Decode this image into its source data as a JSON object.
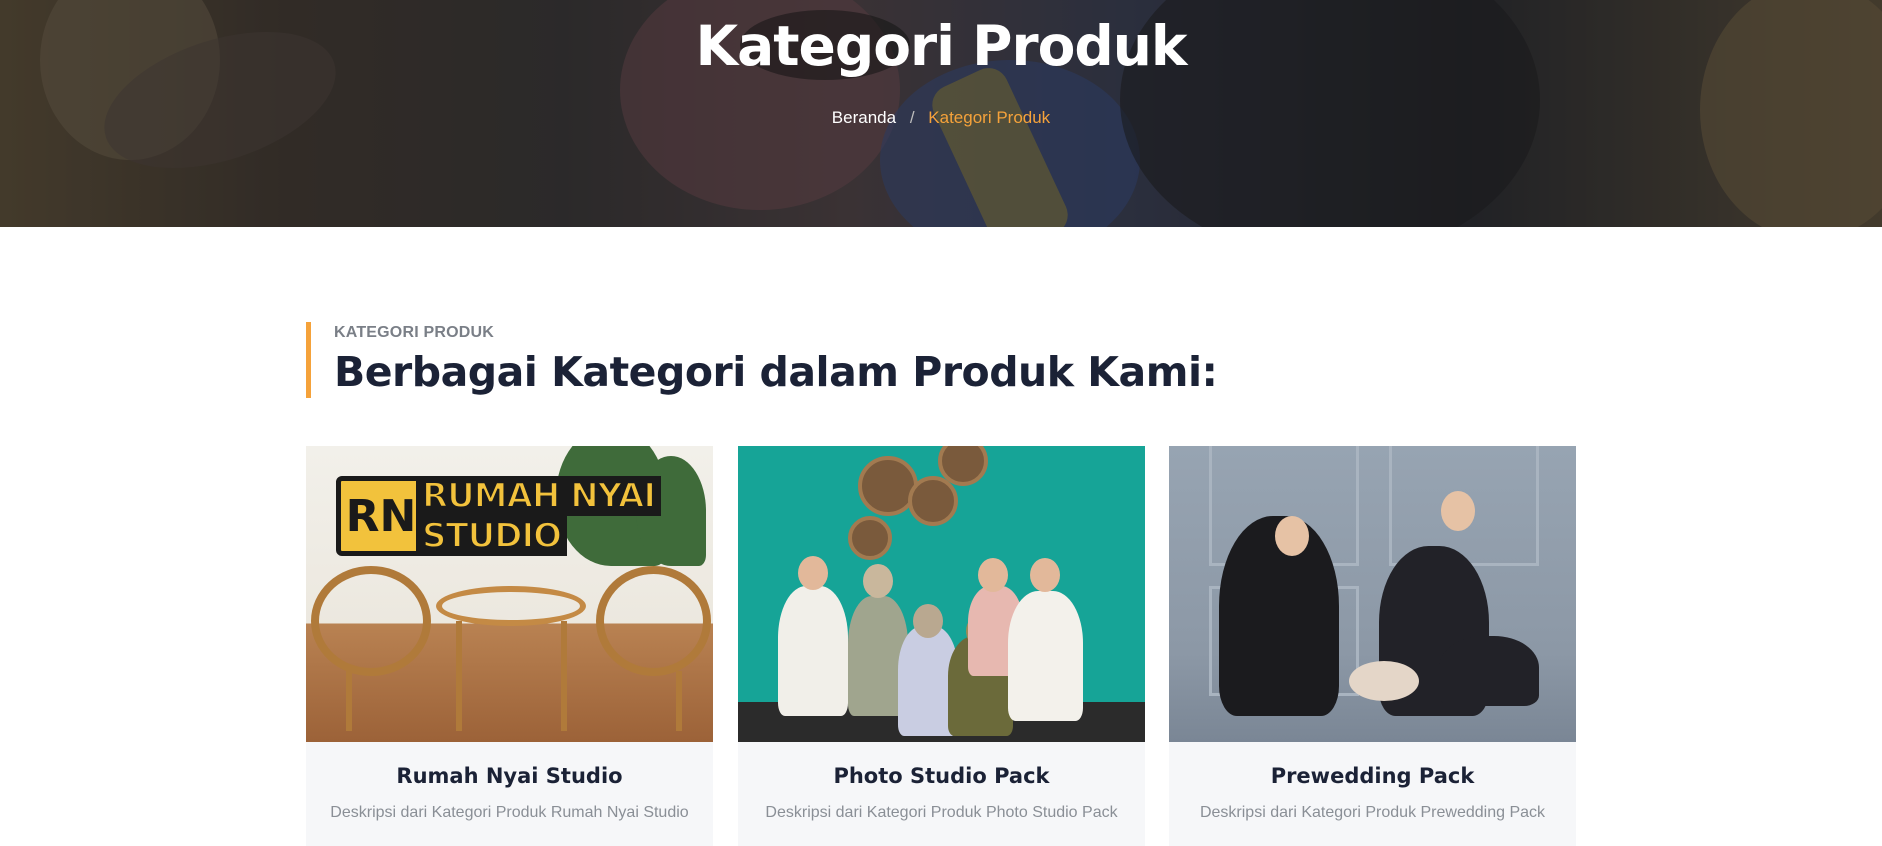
{
  "hero": {
    "title": "Kategori Produk",
    "breadcrumb": {
      "home": "Beranda",
      "separator": "/",
      "current": "Kategori Produk"
    }
  },
  "section": {
    "subtitle": "KATEGORI PRODUK",
    "title": "Berbagai Kategori dalam Produk Kami:"
  },
  "cards": [
    {
      "title": "Rumah Nyai Studio",
      "description": "Deskripsi dari Kategori Produk Rumah Nyai Studio",
      "image_logo_line1": "RUMAH NYAI",
      "image_logo_line2": "STUDIO",
      "image_logo_mark": "RN"
    },
    {
      "title": "Photo Studio Pack",
      "description": "Deskripsi dari Kategori Produk Photo Studio Pack"
    },
    {
      "title": "Prewedding Pack",
      "description": "Deskripsi dari Kategori Produk Prewedding Pack"
    }
  ],
  "colors": {
    "accent": "#f5a23a",
    "heading": "#1b2236",
    "muted": "#8a8f96",
    "card_bg": "#f6f7f9"
  }
}
